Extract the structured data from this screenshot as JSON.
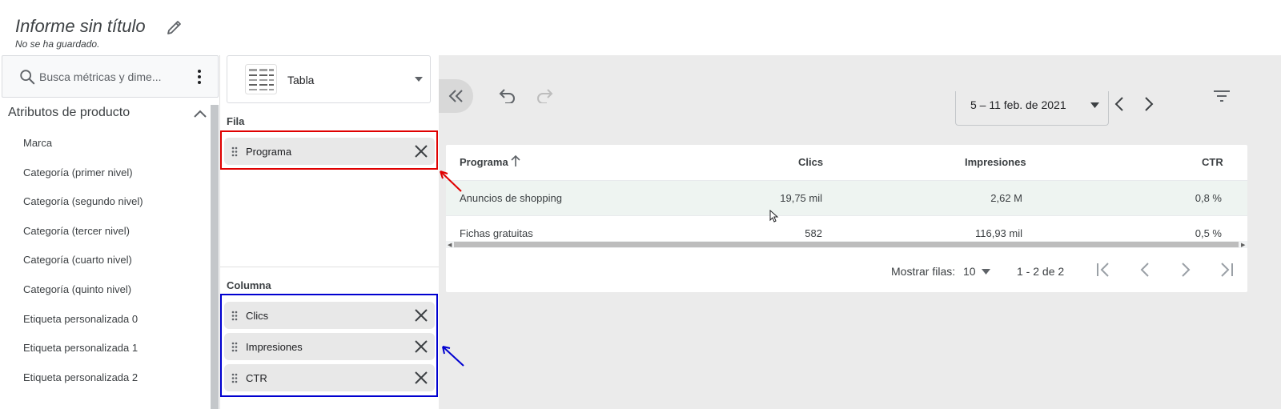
{
  "header": {
    "title": "Informe sin título",
    "subtitle": "No se ha guardado."
  },
  "search": {
    "placeholder": "Busca métricas y dime..."
  },
  "attributes": {
    "group_title": "Atributos de producto",
    "items": [
      "Marca",
      "Categoría (primer nivel)",
      "Categoría (segundo nivel)",
      "Categoría (tercer nivel)",
      "Categoría (cuarto nivel)",
      "Categoría (quinto nivel)",
      "Etiqueta personalizada 0",
      "Etiqueta personalizada 1",
      "Etiqueta personalizada 2"
    ]
  },
  "visualization": {
    "type_label": "Tabla"
  },
  "config": {
    "row_label": "Fila",
    "row_chips": [
      "Programa"
    ],
    "column_label": "Columna",
    "column_chips": [
      "Clics",
      "Impresiones",
      "CTR"
    ]
  },
  "toolbar": {
    "date_range": "5 – 11 feb. de 2021"
  },
  "table": {
    "headers": {
      "programa": "Programa",
      "clics": "Clics",
      "impresiones": "Impresiones",
      "ctr": "CTR"
    },
    "rows": [
      {
        "programa": "Anuncios de shopping",
        "clics": "19,75 mil",
        "impresiones": "2,62 M",
        "ctr": "0,8 %"
      },
      {
        "programa": "Fichas gratuitas",
        "clics": "582",
        "impresiones": "116,93 mil",
        "ctr": "0,5 %"
      }
    ]
  },
  "pagination": {
    "rows_label": "Mostrar filas:",
    "rows_value": "10",
    "range_text": "1 - 2 de 2"
  },
  "colors": {
    "annotation_red": "#e00000",
    "annotation_blue": "#0000d0",
    "highlight_row": "#eef4f1"
  }
}
